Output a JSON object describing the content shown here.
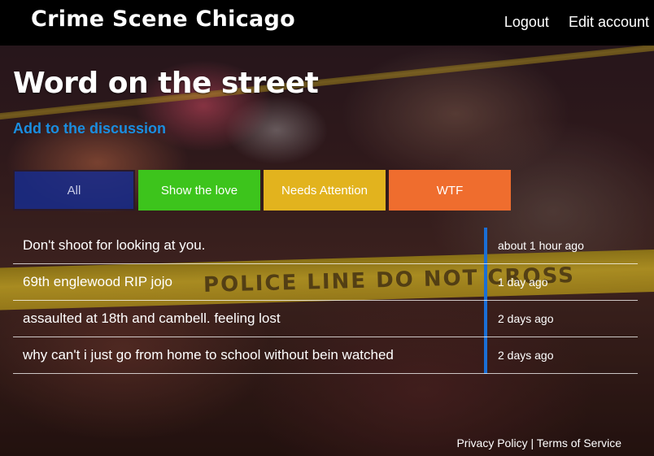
{
  "header": {
    "brand": "Crime Scene Chicago",
    "logout_label": "Logout",
    "edit_account_label": "Edit account"
  },
  "main": {
    "title": "Word on the street",
    "add_link": "Add to the discussion",
    "filters": [
      {
        "label": "All",
        "color": "#1c2e8c"
      },
      {
        "label": "Show the love",
        "color": "#3dc41c"
      },
      {
        "label": "Needs Attention",
        "color": "#e2b31e"
      },
      {
        "label": "WTF",
        "color": "#ef6d2e"
      }
    ],
    "posts": [
      {
        "text": "Don't shoot for looking at you.",
        "time": "about 1 hour ago"
      },
      {
        "text": "69th englewood RIP jojo",
        "time": "1 day ago"
      },
      {
        "text": "assaulted at 18th and cambell. feeling lost",
        "time": "2 days ago"
      },
      {
        "text": "why can't i just go from home to school without bein watched",
        "time": "2 days ago"
      }
    ]
  },
  "background_tape_text": "POLICE LINE DO NOT CROSS",
  "footer": {
    "privacy": "Privacy Policy",
    "separator": "|",
    "terms": "Terms of Service"
  },
  "colors": {
    "accent_link": "#1a8ee0",
    "divider": "#1a6fd6",
    "navbar": "#000000"
  }
}
